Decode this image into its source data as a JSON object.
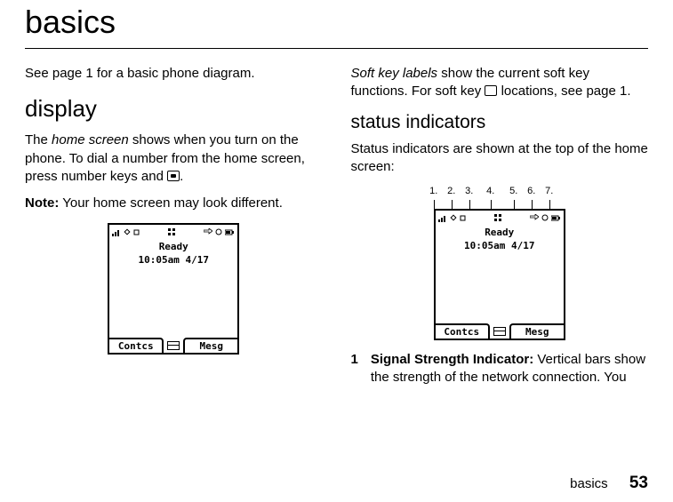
{
  "page_title": "basics",
  "col1": {
    "intro": "See page 1 for a basic phone diagram.",
    "heading_display": "display",
    "display_p1a": "The ",
    "display_p1_italic": "home screen",
    "display_p1b": " shows when you turn on the phone. To dial a number from the home screen, press number keys and ",
    "display_p1c": ".",
    "note_label": "Note:",
    "note_text": " Your home screen may look different."
  },
  "col2": {
    "softkey_p_a_italic": "Soft key labels",
    "softkey_p_a": " show the current soft key functions. For soft key ",
    "softkey_p_b": " locations, see page 1.",
    "heading_status": "status indicators",
    "status_p": "Status indicators are shown at the top of the home screen:",
    "callouts": [
      "1.",
      "2.",
      "3.",
      "4.",
      "5.",
      "6.",
      "7."
    ],
    "list1_num": "1",
    "list1_bold": "Signal Strength Indicator:",
    "list1_text": " Vertical bars show the strength of the network connection. You"
  },
  "phone": {
    "ready": "Ready",
    "datetime": "10:05am 4/17",
    "left_softkey": "Contcs",
    "right_softkey": "Mesg",
    "status_icons": [
      "signal",
      "diamond",
      "square",
      "grid",
      "arrows",
      "dots",
      "battery"
    ]
  },
  "footer": {
    "label": "basics",
    "page": "53"
  }
}
